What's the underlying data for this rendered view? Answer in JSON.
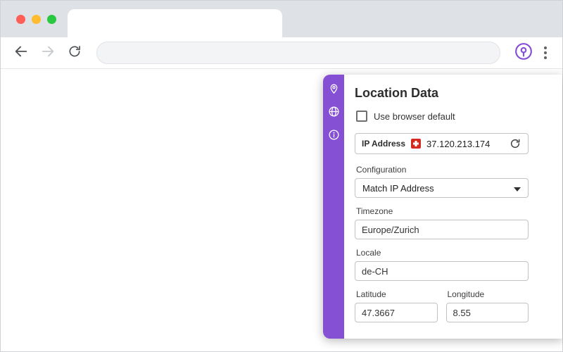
{
  "browser": {
    "tab_title": "",
    "address_bar": {
      "value": "",
      "placeholder": ""
    },
    "traffic_lights": {
      "close": "#ff5f57",
      "minimize": "#febc2e",
      "zoom": "#28c840"
    }
  },
  "panel": {
    "accent_color": "#8650d4",
    "title": "Location Data",
    "use_browser_default": {
      "label": "Use browser default",
      "checked": false
    },
    "ip": {
      "label": "IP Address",
      "value": "37.120.213.174",
      "country": "CH",
      "flag_icon": "swiss-flag-icon",
      "refresh_icon": "refresh-icon"
    },
    "configuration": {
      "label": "Configuration",
      "value": "Match IP Address"
    },
    "timezone": {
      "label": "Timezone",
      "value": "Europe/Zurich"
    },
    "locale": {
      "label": "Locale",
      "value": "de-CH"
    },
    "latitude": {
      "label": "Latitude",
      "value": "47.3667"
    },
    "longitude": {
      "label": "Longitude",
      "value": "8.55"
    },
    "sidebar_icons": [
      "location-pin-icon",
      "globe-icon",
      "info-icon"
    ]
  }
}
